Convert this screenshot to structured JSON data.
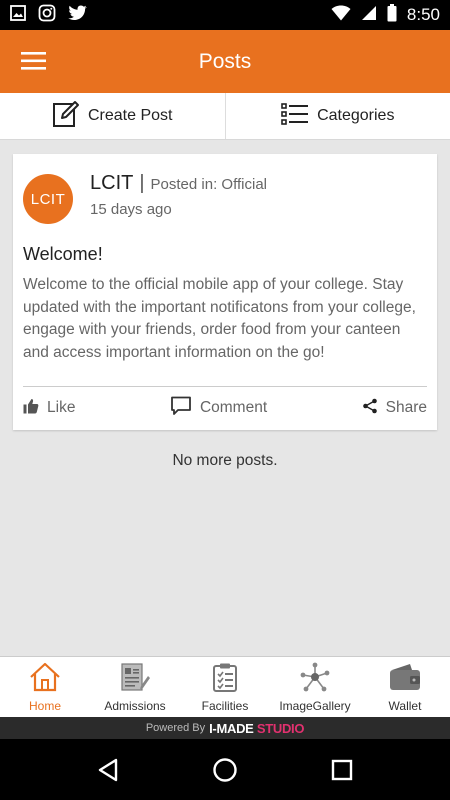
{
  "status_bar": {
    "time": "8:50",
    "icons": [
      "image-icon",
      "instagram-icon",
      "twitter-icon",
      "wifi-icon",
      "battery-icon"
    ]
  },
  "app_bar": {
    "title": "Posts"
  },
  "actions": {
    "create_post": "Create Post",
    "categories": "Categories"
  },
  "post": {
    "avatar_text": "LCIT",
    "author": "LCIT",
    "separator": "|",
    "posted_in": "Posted in: Official",
    "time_ago": "15 days ago",
    "title": "Welcome!",
    "body": "Welcome to the official mobile app of your college. Stay updated with the important notificatons from your college, engage with your friends, order food from your canteen and access important information on the go!",
    "like": "Like",
    "comment": "Comment",
    "share": "Share"
  },
  "feed": {
    "end_text": "No more posts."
  },
  "bottom_nav": {
    "items": [
      {
        "label": "Home",
        "icon": "home-icon",
        "active": true
      },
      {
        "label": "Admissions",
        "icon": "admissions-icon"
      },
      {
        "label": "Facilities",
        "icon": "clipboard-icon"
      },
      {
        "label": "ImageGallery",
        "icon": "network-icon"
      },
      {
        "label": "Wallet",
        "icon": "wallet-icon"
      }
    ]
  },
  "footer": {
    "powered_by": "Powered By",
    "brand_main": "I-MADE",
    "brand_accent": "STUDIO"
  },
  "colors": {
    "accent": "#e8711f",
    "brand_accent": "#e2316f"
  }
}
